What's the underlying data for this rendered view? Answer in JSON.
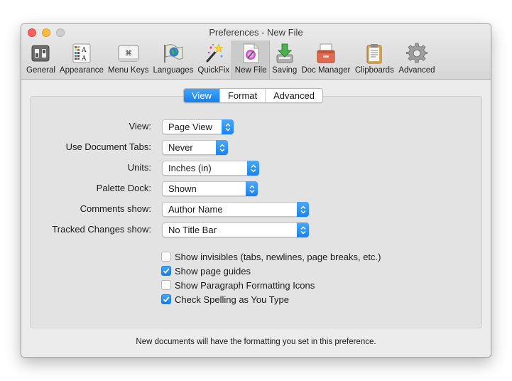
{
  "window": {
    "title": "Preferences - New File"
  },
  "toolbar": {
    "items": [
      {
        "label": "General",
        "icon": "general-switches-icon"
      },
      {
        "label": "Appearance",
        "icon": "appearance-palette-icon"
      },
      {
        "label": "Menu Keys",
        "icon": "command-key-icon"
      },
      {
        "label": "Languages",
        "icon": "globe-flag-icon"
      },
      {
        "label": "QuickFix",
        "icon": "magic-wand-icon"
      },
      {
        "label": "New File",
        "icon": "new-file-icon",
        "selected": true
      },
      {
        "label": "Saving",
        "icon": "save-download-icon"
      },
      {
        "label": "Doc Manager",
        "icon": "doc-manager-tray-icon"
      },
      {
        "label": "Clipboards",
        "icon": "clipboard-icon"
      },
      {
        "label": "Advanced",
        "icon": "gear-icon"
      }
    ]
  },
  "tabs": [
    {
      "label": "View",
      "active": true
    },
    {
      "label": "Format",
      "active": false
    },
    {
      "label": "Advanced",
      "active": false
    }
  ],
  "settings": {
    "view": {
      "label": "View:",
      "value": "Page View"
    },
    "document_tabs": {
      "label": "Use Document Tabs:",
      "value": "Never"
    },
    "units": {
      "label": "Units:",
      "value": "Inches (in)"
    },
    "palette_dock": {
      "label": "Palette Dock:",
      "value": "Shown"
    },
    "comments_show": {
      "label": "Comments show:",
      "value": "Author Name"
    },
    "tracked_changes": {
      "label": "Tracked Changes show:",
      "value": "No Title Bar"
    }
  },
  "checkboxes": [
    {
      "label": "Show invisibles (tabs, newlines, page breaks, etc.)",
      "checked": false
    },
    {
      "label": "Show page guides",
      "checked": true
    },
    {
      "label": "Show Paragraph Formatting Icons",
      "checked": false
    },
    {
      "label": "Check Spelling as You Type",
      "checked": true
    }
  ],
  "footer": {
    "text": "New documents will have the formatting you set in this preference."
  },
  "colors": {
    "accent": "#1a83ee",
    "window_bg": "#ececec",
    "panel_bg": "#e3e3e3"
  }
}
